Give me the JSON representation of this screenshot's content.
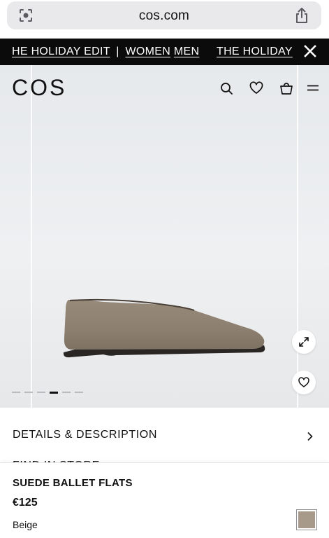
{
  "browser": {
    "domain": "cos.com",
    "lens_icon": "camera-search-icon",
    "share_icon": "share-icon"
  },
  "promo": {
    "part1": "HE HOLIDAY EDIT",
    "separator": "|",
    "link_women": "WOMEN",
    "link_men": "MEN",
    "part2": "THE HOLIDAY",
    "close_icon": "close-icon"
  },
  "header": {
    "logo": "COS",
    "icons": [
      "search-icon",
      "heart-icon",
      "bag-icon",
      "menu-icon"
    ]
  },
  "gallery": {
    "slide_count": 6,
    "active_slide": 4,
    "expand_icon": "expand-icon",
    "wishlist_icon": "heart-icon"
  },
  "details": {
    "label": "DETAILS & DESCRIPTION",
    "next_label": "FIND IN STORE"
  },
  "product": {
    "name": "SUEDE BALLET FLATS",
    "price": "€125",
    "color": "Beige",
    "swatch_color": "#a89a8a"
  }
}
